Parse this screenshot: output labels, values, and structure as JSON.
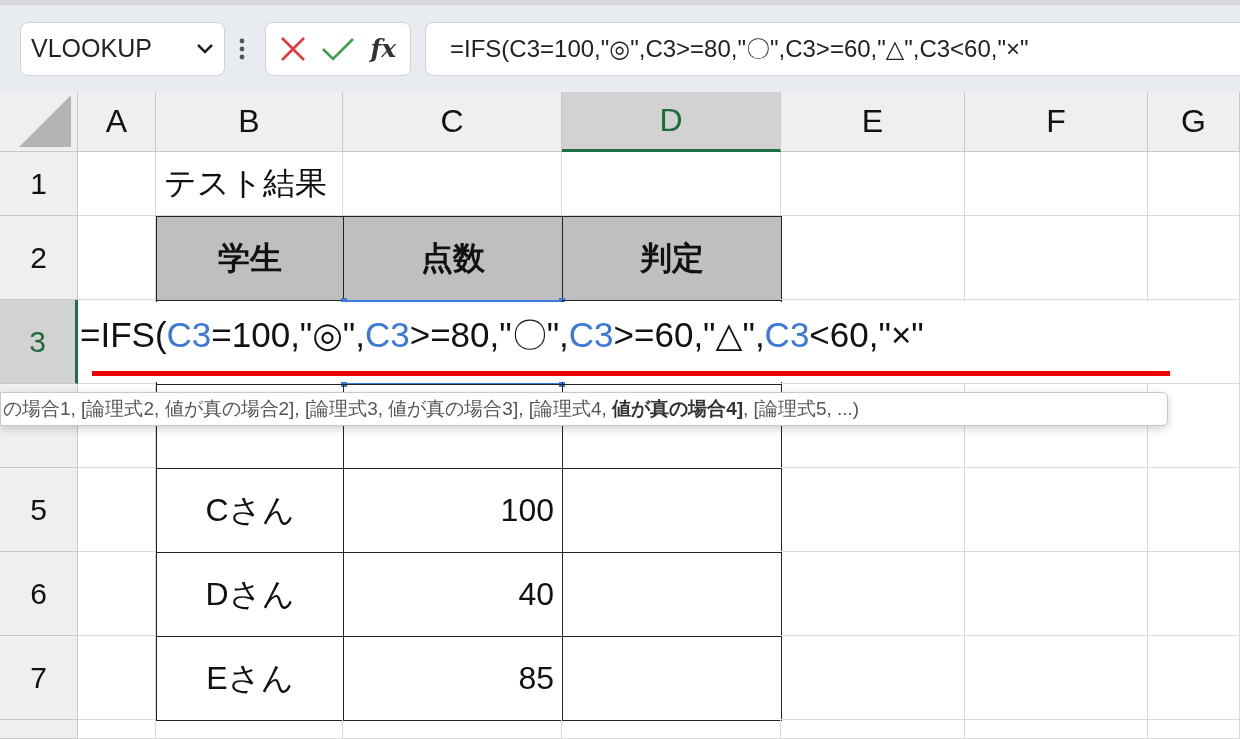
{
  "name_box": {
    "value": "VLOOKUP"
  },
  "fx_label": "fx",
  "formula_bar": {
    "value": "=IFS(C3=100,\"◎\",C3>=80,\"〇\",C3>=60,\"△\",C3<60,\"×\""
  },
  "columns": [
    {
      "label": "A",
      "selected": false
    },
    {
      "label": "B",
      "selected": false
    },
    {
      "label": "C",
      "selected": false
    },
    {
      "label": "D",
      "selected": true
    },
    {
      "label": "E",
      "selected": false
    },
    {
      "label": "F",
      "selected": false
    },
    {
      "label": "G",
      "selected": false
    }
  ],
  "rows": [
    {
      "label": "1",
      "selected": false
    },
    {
      "label": "2",
      "selected": false
    },
    {
      "label": "3",
      "selected": true
    },
    {
      "selected": false
    },
    {
      "label": "5",
      "selected": false
    },
    {
      "label": "6",
      "selected": false
    },
    {
      "label": "7",
      "selected": false
    }
  ],
  "title": "テスト結果",
  "table": {
    "columns": [
      "学生",
      "点数",
      "判定"
    ],
    "rows": [
      [
        "Cさん",
        "100"
      ],
      [
        "Dさん",
        "40"
      ],
      [
        "Eさん",
        "85"
      ]
    ]
  },
  "cell_editor": {
    "parts": [
      {
        "kind": "text",
        "text": "=IFS("
      },
      {
        "kind": "ref",
        "text": "C3"
      },
      {
        "kind": "text",
        "text": "=100,\"◎\","
      },
      {
        "kind": "ref",
        "text": "C3"
      },
      {
        "kind": "text",
        "text": ">=80,\"〇\","
      },
      {
        "kind": "ref",
        "text": "C3"
      },
      {
        "kind": "text",
        "text": ">=60,\"△\","
      },
      {
        "kind": "ref",
        "text": "C3"
      },
      {
        "kind": "text",
        "text": "<60,\"×\""
      }
    ]
  },
  "tooltip": "の場合1, [論理式2, 値が真の場合2], [論理式3, 値が真の場合3], [論理式4, **値が真の場合4]**, [論理式5, ...)"
}
